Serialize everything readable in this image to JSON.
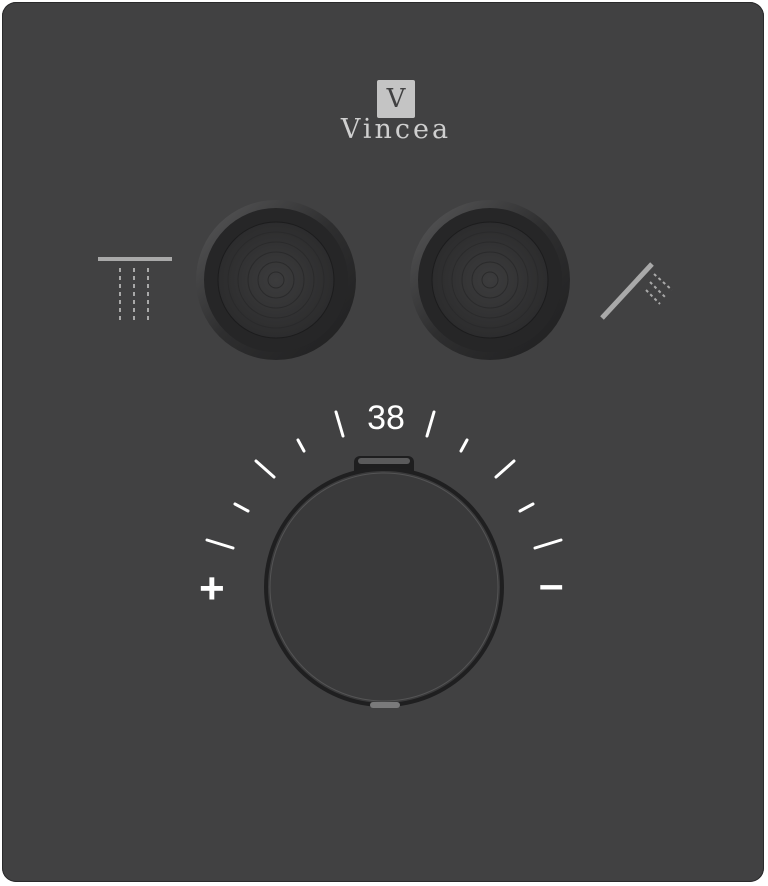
{
  "brand": {
    "logo_letter": "V",
    "name": "Vincea"
  },
  "thermostat": {
    "temperature": "38",
    "increase_label": "+",
    "decrease_label": "–"
  },
  "icons": {
    "left_outlet": "rain-shower-head-icon",
    "right_outlet": "hand-shower-icon"
  },
  "colors": {
    "panel": "#414142",
    "knob_ring": "#2f2f30",
    "knob_face": "#3a3a3b",
    "markings": "#ffffff"
  }
}
